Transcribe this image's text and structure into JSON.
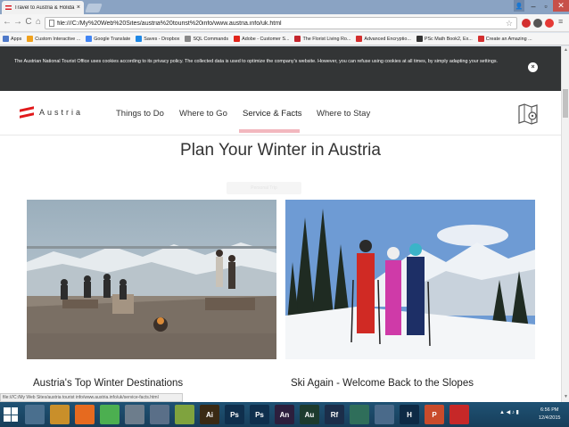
{
  "browser": {
    "tab_title": "Travel to Austria & Holida",
    "tab_close": "×",
    "url": "file:///C:/My%20Web%20Sites/austria%20tourist%20info/www.austria.info/uk.html",
    "back": "←",
    "forward": "→",
    "reload": "C",
    "home": "⌂",
    "user": "👤",
    "minimize": "–",
    "maximize": "▫",
    "close": "✕",
    "star": "☆",
    "menu": "≡"
  },
  "bookmarks": [
    {
      "label": "Apps",
      "color": "#4f79c9"
    },
    {
      "label": "Custom Interactive ...",
      "color": "#f0a11c"
    },
    {
      "label": "Google Translate",
      "color": "#4285f4"
    },
    {
      "label": "Saves - Dropbox",
      "color": "#1f88e5"
    },
    {
      "label": "SQL Commands",
      "color": "#888888"
    },
    {
      "label": "Adobe - Customer S...",
      "color": "#e1251b"
    },
    {
      "label": "The Florist Living Ro...",
      "color": "#c4262e"
    },
    {
      "label": "Advanced Encryptio...",
      "color": "#d32f2f"
    },
    {
      "label": "PSc Math Book2, Ex...",
      "color": "#333333"
    },
    {
      "label": "Create an Amazing ...",
      "color": "#d32f2f"
    }
  ],
  "cookie": {
    "text": "The Austrian National Tourist Office uses cookies according to its privacy policy. The collected data is used to optimize the company's website. However, you can refuse using cookies at all times, by simply adapting your settings.",
    "close": "×"
  },
  "site": {
    "brand": "Austria",
    "nav": [
      "Things to Do",
      "Where to Go",
      "Service & Facts",
      "Where to Stay"
    ],
    "active_nav": "Service & Facts",
    "headline": "Plan Your Winter in Austria",
    "ghost_button": "Personal Trip",
    "cards": [
      {
        "title": "Austria's Top Winter Destinations"
      },
      {
        "title": "Ski Again - Welcome Back to the Slopes"
      }
    ]
  },
  "status_url": "file:///C:/My Web Sites/austria tourist info/www.austria.info/uk/service-facts.html",
  "taskbar": {
    "apps": [
      {
        "label": "",
        "color": "#4a6f8e"
      },
      {
        "label": "",
        "color": "#c98f2a"
      },
      {
        "label": "",
        "color": "#e66a1f"
      },
      {
        "label": "",
        "color": "#4caf50"
      },
      {
        "label": "",
        "color": "#6d7d8c"
      },
      {
        "label": "",
        "color": "#5a6f88"
      },
      {
        "label": "",
        "color": "#7fa33e"
      },
      {
        "label": "Ai",
        "color": "#3a2a14"
      },
      {
        "label": "Ps",
        "color": "#0f2f4d"
      },
      {
        "label": "Ps",
        "color": "#0f2f4d"
      },
      {
        "label": "An",
        "color": "#2c1f3d"
      },
      {
        "label": "Au",
        "color": "#1d3b2e"
      },
      {
        "label": "Rf",
        "color": "#1b2e4a"
      },
      {
        "label": "",
        "color": "#2f6e5a"
      },
      {
        "label": "",
        "color": "#4a6a8a"
      },
      {
        "label": "H",
        "color": "#0e2a45"
      },
      {
        "label": "P",
        "color": "#c94b2b"
      },
      {
        "label": "",
        "color": "#c62828"
      }
    ],
    "time": "6:56 PM",
    "date": "12/4/2015"
  },
  "colors": {
    "accent_red": "#e1191b",
    "active_underline": "#f2b7be",
    "cookie_bg": "#333536"
  }
}
